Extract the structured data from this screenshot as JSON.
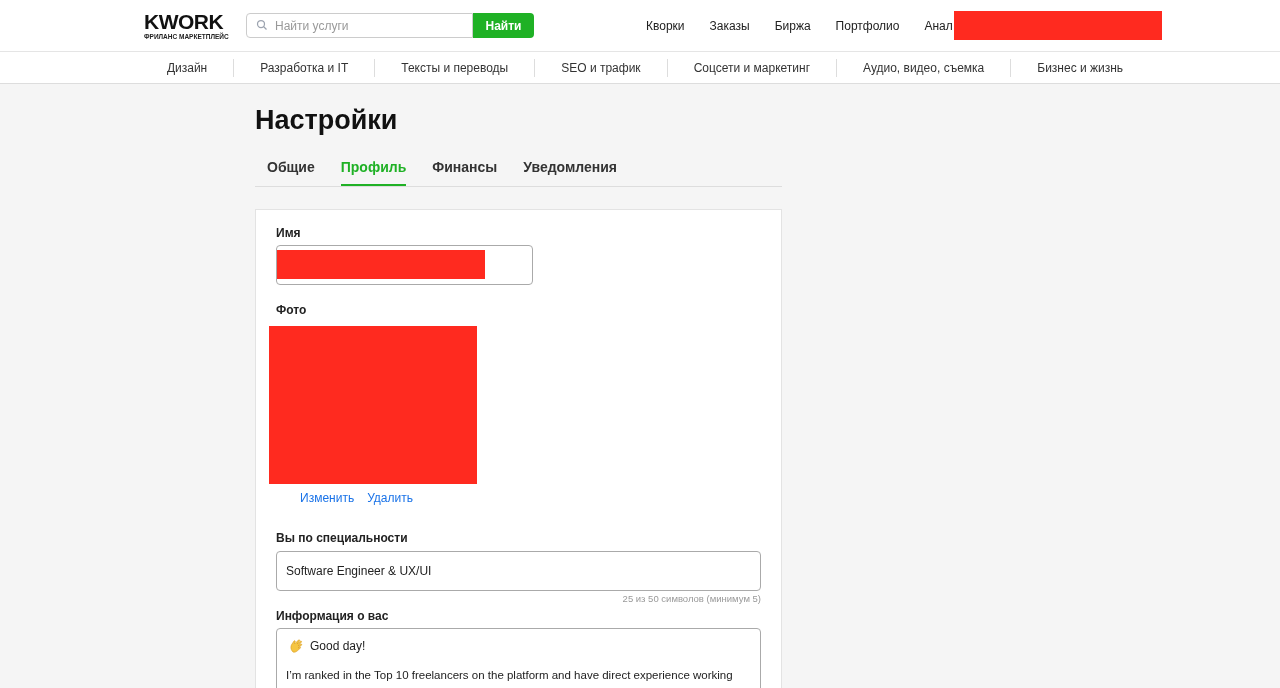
{
  "header": {
    "logo": {
      "wordmark": "KWORK",
      "tagline": "ФРИЛАНС МАРКЕТПЛЕЙС"
    },
    "search": {
      "placeholder": "Найти услуги",
      "button": "Найти"
    },
    "nav": [
      "Кворки",
      "Заказы",
      "Биржа",
      "Портфолио",
      "Анал"
    ]
  },
  "categories": [
    "Дизайн",
    "Разработка и IT",
    "Тексты и переводы",
    "SEO и трафик",
    "Соцсети и маркетинг",
    "Аудио, видео, съемка",
    "Бизнес и жизнь"
  ],
  "page": {
    "title": "Настройки",
    "tabs": [
      {
        "label": "Общие",
        "selected": false
      },
      {
        "label": "Профиль",
        "selected": true
      },
      {
        "label": "Финансы",
        "selected": false
      },
      {
        "label": "Уведомления",
        "selected": false
      }
    ],
    "form": {
      "name_label": "Имя",
      "photo_label": "Фото",
      "photo_actions": [
        "Изменить",
        "Удалить"
      ],
      "specialty": {
        "label": "Вы по специальности",
        "value": "Software Engineer & UX/UI",
        "hint": "25 из 50 символов (минимум 5)"
      },
      "about": {
        "label": "Информация о вас",
        "lines": [
          "Good day!",
          "I’m ranked in the Top 10 freelancers on the platform and have direct experience working"
        ]
      }
    }
  }
}
